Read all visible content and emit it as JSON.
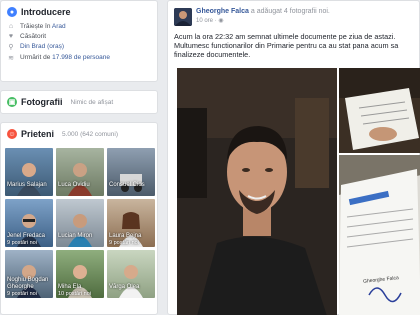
{
  "intro": {
    "title": "Introducere",
    "rows": [
      {
        "icon": "home-icon",
        "prefix": "Trăiește în ",
        "link": "Arad"
      },
      {
        "icon": "heart-icon",
        "prefix": "Căsătorit",
        "link": ""
      },
      {
        "icon": "location-icon",
        "prefix": "",
        "link": "Din Brad (oraș)"
      },
      {
        "icon": "rss-icon",
        "prefix": "Urmărit de ",
        "link": "17.998 de persoane"
      }
    ]
  },
  "photos": {
    "title": "Fotografii",
    "empty_text": "Nimic de afișat"
  },
  "friends": {
    "title": "Prieteni",
    "count": "5.000 (642 comuni)",
    "items": [
      {
        "name": "Marius Salajan",
        "sub": ""
      },
      {
        "name": "Luca Ovidiu",
        "sub": ""
      },
      {
        "name": "Consuel Cios",
        "sub": ""
      },
      {
        "name": "Jenel Fredaca",
        "sub": "9 postări noi"
      },
      {
        "name": "Lucian Miron",
        "sub": ""
      },
      {
        "name": "Laura Bejna",
        "sub": "9 postări noi"
      },
      {
        "name": "Noghiu Bogdan Gheorghe",
        "sub": "9 postări noi"
      },
      {
        "name": "Miha Ela",
        "sub": "10 postări noi"
      },
      {
        "name": "Vărga Olea",
        "sub": ""
      }
    ]
  },
  "post": {
    "author": "Gheorghe Falca",
    "action": " a adăugat 4 fotografii noi.",
    "time": "10 ore",
    "text": "Acum la ora 22:32 am semnat ultimele documente pe ziua de astazi. Multumesc functionarilor din Primarie pentru ca au stat pana acum sa finalizeze documentele.",
    "doc_text": "Gheorghe Falca"
  },
  "colors": {
    "fb_blue": "#365899",
    "intro_icon": "#4080ff",
    "photos_icon": "#45bd62",
    "friends_icon": "#f7533e"
  }
}
